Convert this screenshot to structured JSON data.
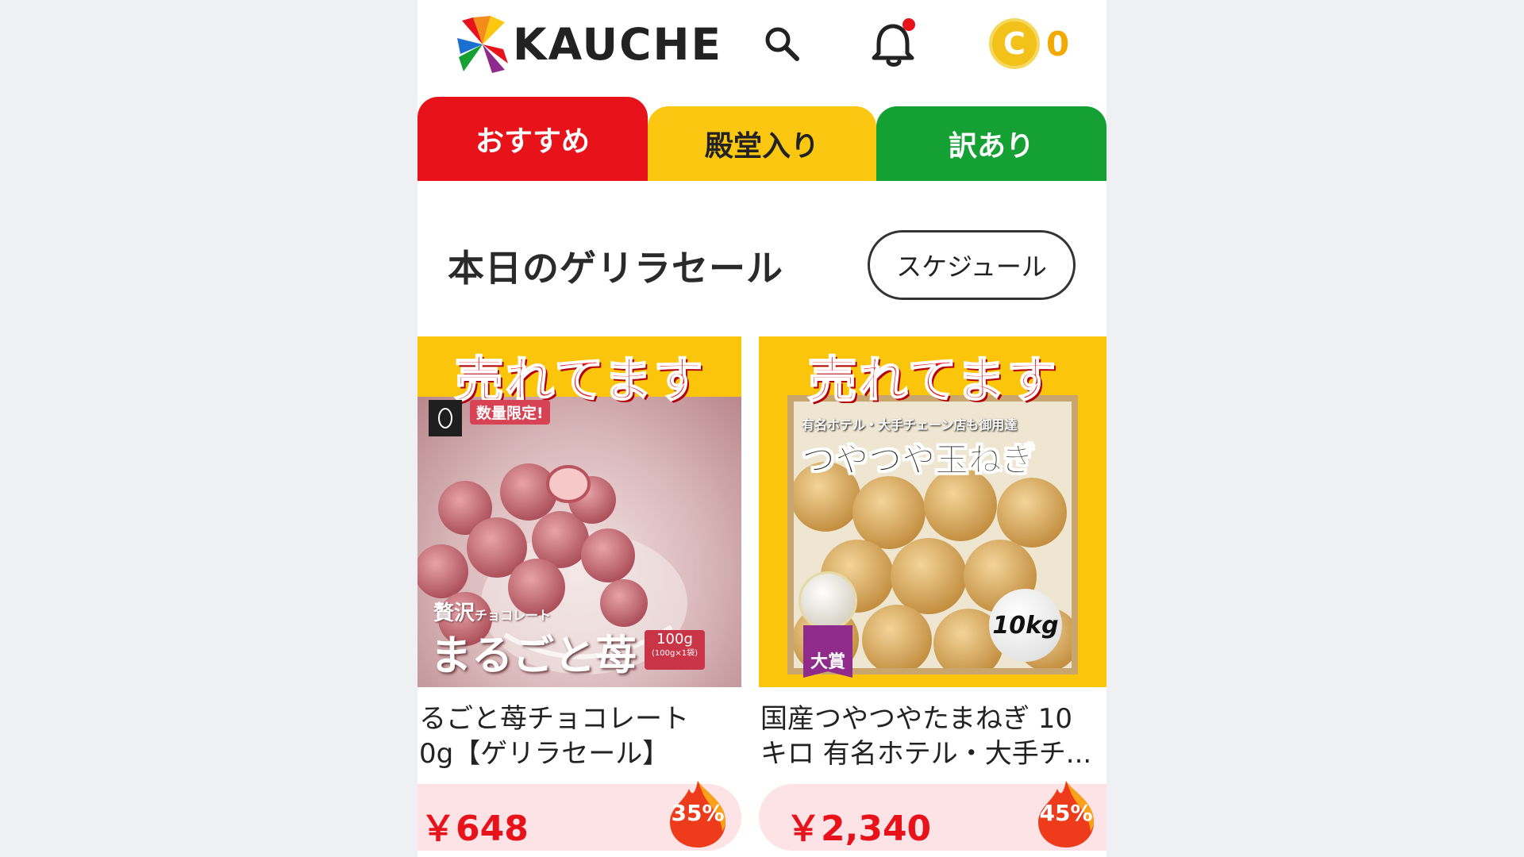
{
  "header": {
    "logo_text": "KAUCHE",
    "coin_count": "0",
    "coin_symbol": "C",
    "icons": [
      "search-icon",
      "bell-icon",
      "coin-icon"
    ],
    "notification_dot_color": "#e8121a"
  },
  "tabs": [
    {
      "label": "おすすめ",
      "color": "#e8121a",
      "active": true
    },
    {
      "label": "殿堂入り",
      "color": "#fbc711",
      "active": false
    },
    {
      "label": "訳あり",
      "color": "#14a032",
      "active": false
    }
  ],
  "section": {
    "title": "本日のゲリラセール",
    "schedule_button": "スケジュール"
  },
  "products": [
    {
      "banner": "売れてます",
      "image_text": {
        "limited": "数量限定!",
        "line1": "贅沢",
        "line1_small": "チョコレート",
        "line2": "まるごと苺",
        "weight": "100g",
        "weight_small": "(100g×1袋)"
      },
      "name_line1": "るごと苺チョコレート",
      "name_line2": "0g【ゲリラセール】",
      "price": "￥648",
      "discount": "35%"
    },
    {
      "banner": "売れてます",
      "image_text": {
        "subtitle": "有名ホテル・大手チェーン店も御用達",
        "title": "つやつや玉ねぎ",
        "weight": "10kg",
        "award": "大賞"
      },
      "name_line1": "国産つやつやたまねぎ 10",
      "name_line2": "キロ 有名ホテル・大手チ...",
      "price": "￥2,340",
      "discount": "45%"
    }
  ],
  "colors": {
    "brand_red": "#e8121a",
    "brand_yellow": "#fbc711",
    "brand_green": "#14a032",
    "price_bg": "#fde3e6",
    "coin": "#f2c21b"
  }
}
